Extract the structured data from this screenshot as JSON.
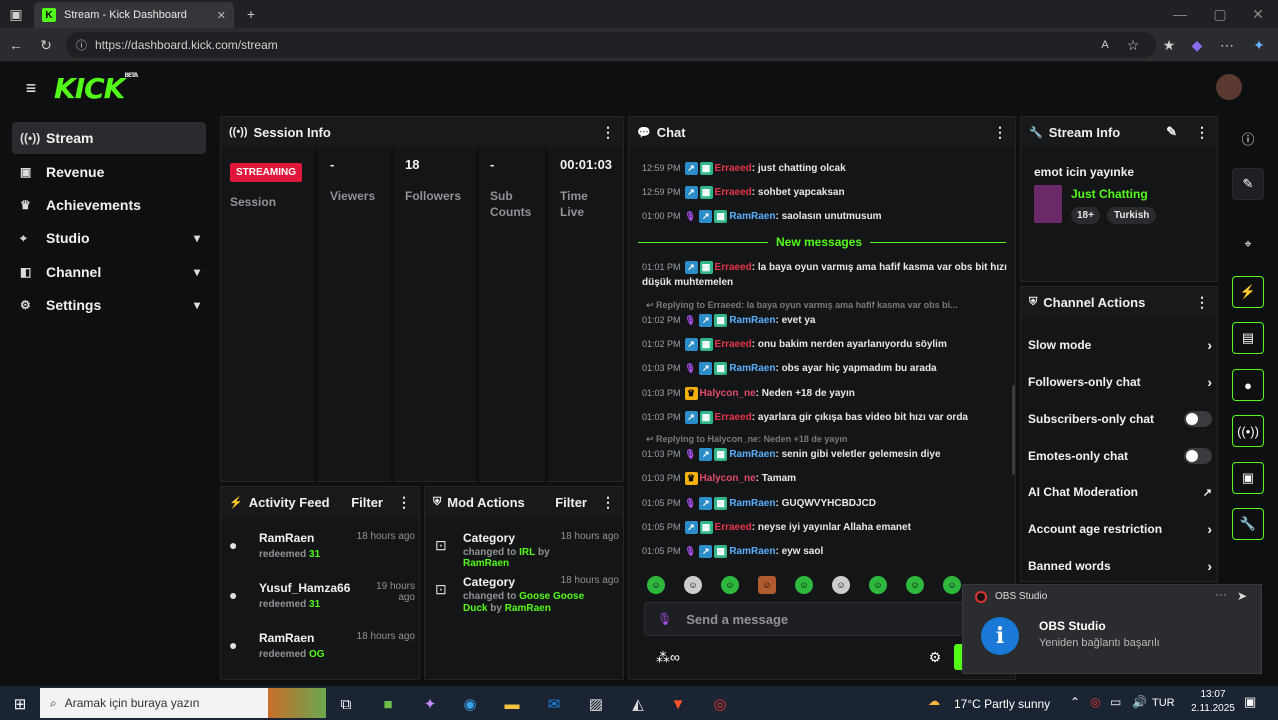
{
  "browser": {
    "tab_title": "Stream - Kick Dashboard",
    "url": "https://dashboard.kick.com/stream"
  },
  "app": {
    "logo": "KICK",
    "logo_sup": "BETA"
  },
  "nav": [
    {
      "label": "Stream",
      "icon": "broadcast-icon",
      "active": true
    },
    {
      "label": "Revenue",
      "icon": "wallet-icon"
    },
    {
      "label": "Achievements",
      "icon": "trophy-icon"
    },
    {
      "label": "Studio",
      "icon": "studio-icon",
      "expandable": true
    },
    {
      "label": "Channel",
      "icon": "channel-icon",
      "expandable": true
    },
    {
      "label": "Settings",
      "icon": "gear-icon",
      "expandable": true
    }
  ],
  "session": {
    "title": "Session Info",
    "status_badge": "STREAMING",
    "session_label": "Session",
    "viewers_value": "-",
    "viewers_label": "Viewers",
    "followers_value": "18",
    "followers_label": "Followers",
    "subs_value": "-",
    "subs_label_1": "Sub",
    "subs_label_2": "Counts",
    "time_value": "00:01:03",
    "time_label_1": "Time",
    "time_label_2": "Live"
  },
  "activity": {
    "title": "Activity Feed",
    "filter": "Filter",
    "items": [
      {
        "name": "RamRaen",
        "action": "redeemed",
        "value": "31",
        "ago": "18 hours ago"
      },
      {
        "name": "Yusuf_Hamza66",
        "action": "redeemed",
        "value": "31",
        "ago": "19 hours ago"
      },
      {
        "name": "RamRaen",
        "action": "redeemed",
        "value": "OG",
        "ago": "18 hours ago"
      }
    ]
  },
  "mod": {
    "title": "Mod Actions",
    "filter": "Filter",
    "items": [
      {
        "title": "Category",
        "pre": "changed to",
        "value": "IRL",
        "by": "by",
        "user": "RamRaen",
        "ago": "18 hours ago"
      },
      {
        "title": "Category",
        "pre": "changed to",
        "value": "Goose Goose Duck",
        "by": "by",
        "user": "RamRaen",
        "ago": "18 hours ago"
      }
    ]
  },
  "chat": {
    "title": "Chat",
    "new_messages": "New messages",
    "messages": [
      {
        "time": "12:59 PM",
        "user": "Erraeed",
        "text": "just chatting olcak"
      },
      {
        "time": "12:59 PM",
        "user": "Erraeed",
        "text": "sohbet yapcaksan"
      },
      {
        "time": "01:00 PM",
        "user": "RamRaen",
        "text": "saolasın unutmusum"
      },
      {
        "time": "01:01 PM",
        "user": "Erraeed",
        "text": "la baya oyun varmış ama hafif kasma var obs bit hızı düşük muhtemelen"
      },
      {
        "time": "01:02 PM",
        "user": "RamRaen",
        "text": "evet ya"
      },
      {
        "time": "01:02 PM",
        "user": "Erraeed",
        "text": "onu bakim nerden ayarlanıyordu söylim"
      },
      {
        "time": "01:03 PM",
        "user": "RamRaen",
        "text": "obs ayar hiç yapmadım bu arada"
      },
      {
        "time": "01:03 PM",
        "user": "Halycon_ne",
        "text": "Neden +18 de yayın"
      },
      {
        "time": "01:03 PM",
        "user": "Erraeed",
        "text": "ayarlara gir çıkışa bas video bit hızı var orda"
      },
      {
        "time": "01:03 PM",
        "user": "RamRaen",
        "text": "senin gibi veletler gelemesin diye"
      },
      {
        "time": "01:03 PM",
        "user": "Halycon_ne",
        "text": "Tamam"
      },
      {
        "time": "01:05 PM",
        "user": "RamRaen",
        "text": "GUQWVYHCBDJCD"
      },
      {
        "time": "01:05 PM",
        "user": "Erraeed",
        "text": "neyse iyi yayınlar Allaha emanet"
      },
      {
        "time": "01:05 PM",
        "user": "RamRaen",
        "text": "eyw saol"
      }
    ],
    "reply1": "Replying to Erraeed: la baya oyun varmış ama hafif kasma var obs bi...",
    "reply2": "Replying to Halycon_ne: Neden +18 de yayın",
    "input_placeholder": "Send a message"
  },
  "stream_info": {
    "title": "Stream Info",
    "stream_title": "emot icin yayınke",
    "category": "Just Chatting",
    "tags": [
      "18+",
      "Turkish"
    ]
  },
  "channel_actions": {
    "title": "Channel Actions",
    "items": [
      {
        "label": "Slow mode",
        "control": "arrow"
      },
      {
        "label": "Followers-only chat",
        "control": "arrow"
      },
      {
        "label": "Subscribers-only chat",
        "control": "toggle"
      },
      {
        "label": "Emotes-only chat",
        "control": "toggle"
      },
      {
        "label": "AI Chat Moderation",
        "control": "external"
      },
      {
        "label": "Account age restriction",
        "control": "arrow"
      },
      {
        "label": "Banned words",
        "control": "arrow"
      }
    ]
  },
  "notification": {
    "app": "OBS Studio",
    "title": "OBS Studio",
    "body": "Yeniden bağlantı başarılı"
  },
  "taskbar": {
    "search_placeholder": "Aramak için buraya yazın",
    "weather": "17°C  Partly sunny",
    "lang": "TUR",
    "time": "13:07",
    "date": "2.11.2025"
  },
  "colors": {
    "accent": "#53fc18",
    "streaming": "#e0163a"
  }
}
